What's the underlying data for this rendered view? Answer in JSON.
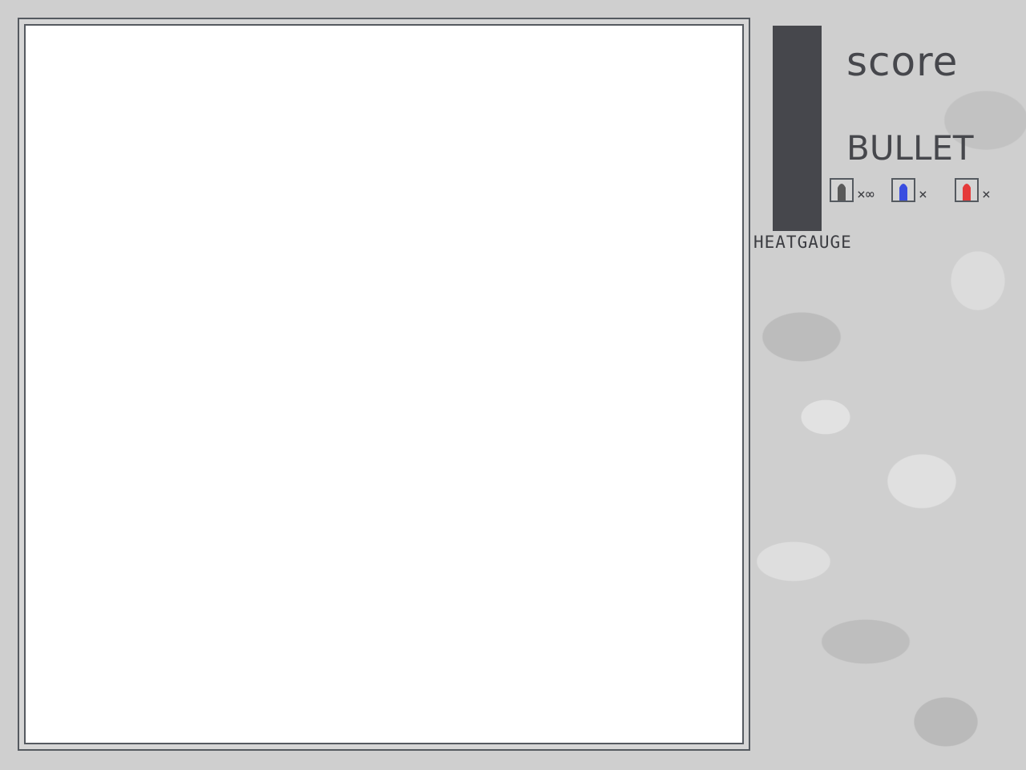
{
  "hud": {
    "score_label": "score",
    "bullet_label": "BULLET",
    "heat_label": "HEATGAUGE",
    "heat_level": 0
  },
  "ammo": [
    {
      "icon": "gray-bullet-icon",
      "color": "#5a5a5a",
      "count_text": "×∞"
    },
    {
      "icon": "blue-bullet-icon",
      "color": "#3a4ee0",
      "count_text": "×"
    },
    {
      "icon": "red-bullet-icon",
      "color": "#e53a3a",
      "count_text": "×"
    }
  ],
  "colors": {
    "frame": "#555a60",
    "gauge": "#46474c",
    "text": "#46474c"
  }
}
